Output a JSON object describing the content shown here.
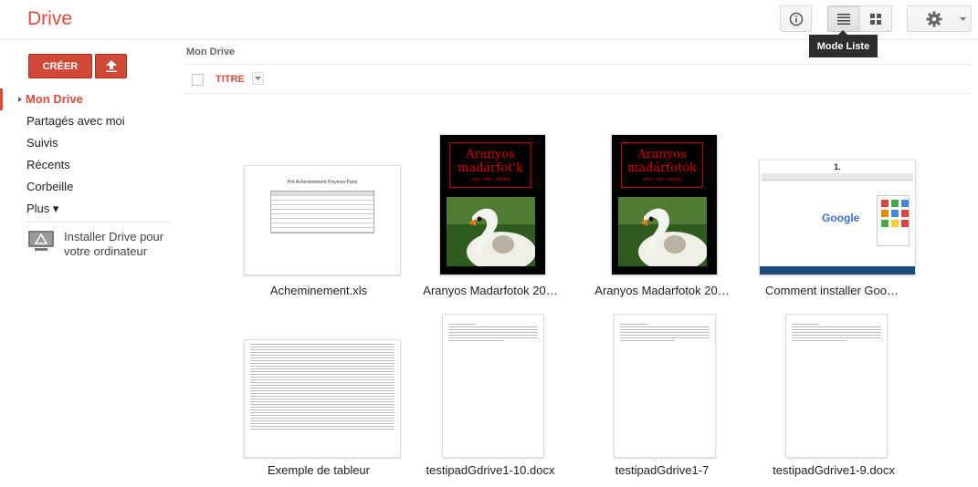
{
  "app": {
    "title": "Drive"
  },
  "header": {
    "tooltip": "Mode Liste"
  },
  "sidebar": {
    "create_label": "CRÉER",
    "items": [
      {
        "label": "Mon Drive"
      },
      {
        "label": "Partagés avec moi"
      },
      {
        "label": "Suivis"
      },
      {
        "label": "Récents"
      },
      {
        "label": "Corbeille"
      },
      {
        "label": "Plus ▾"
      }
    ],
    "install": {
      "line1": "Installer Drive pour",
      "line2": "votre ordinateur"
    }
  },
  "main": {
    "breadcrumb": "Mon Drive",
    "column_title": "TITRE",
    "files": [
      {
        "name": "Acheminement.xls"
      },
      {
        "name": "Aranyos Madarfotok 20…"
      },
      {
        "name": "Aranyos Madarfotok 20…"
      },
      {
        "name": "Comment installer Goo…"
      },
      {
        "name": "Exemple de tableur"
      },
      {
        "name": "testipadGdrive1-10.docx"
      },
      {
        "name": "testipadGdrive1-7"
      },
      {
        "name": "testipadGdrive1-9.docx"
      }
    ],
    "thumbs": {
      "xls_heading": "Pré Acheminement Province-Paris",
      "poster_title1": "Aranyos",
      "poster_title2a": "madárfot'k",
      "poster_title2b": "madárfotók",
      "poster_sub": "szöv · fotó · photos",
      "browser_num": "1.",
      "google": "Google"
    }
  },
  "colors": {
    "accent": "#dd4b39",
    "create_button": "#d14836"
  }
}
